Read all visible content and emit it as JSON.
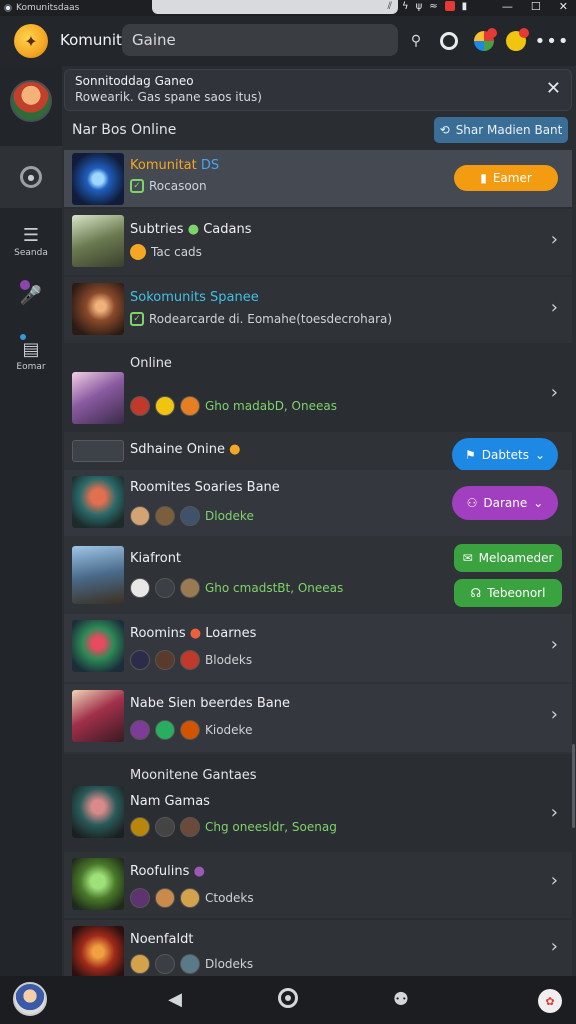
{
  "titlebar": {
    "app_name": "Komunitsdaas",
    "window_controls": [
      "—",
      "☐",
      "✕"
    ]
  },
  "header": {
    "brand": "Komunits",
    "search_value": "Gaine"
  },
  "sidebar": {
    "items": [
      {
        "label": "Seanda",
        "icon": "list-icon"
      },
      {
        "label": "",
        "icon": "mic-icon"
      },
      {
        "label": "Eomar",
        "icon": "flag-icon"
      }
    ]
  },
  "banner": {
    "title": "Sonnitoddag Ganeo",
    "subtitle": "Rowearik. Gas spane saos itus)",
    "close": "✕"
  },
  "now_online_label": "Nar Bos Online",
  "share_button": "Shar Madien Bant",
  "rows": [
    {
      "title": "Komunitat",
      "badge": "DS",
      "sub": "Rocasoon",
      "action": "Eamer"
    },
    {
      "title": "Subtries",
      "sub": "Tac cads"
    },
    {
      "title": "Sokomunits Spanee",
      "sub": "Rodearcarde di. Eomahe(toesdecrohara)"
    },
    {
      "group_label": "Online",
      "sub": "Gho madabD, Oneeas"
    },
    {
      "title": "Sdhaine Onine",
      "action": "Dabtets"
    },
    {
      "title": "Roomites Soaries Bane",
      "sub": "Dlodeke",
      "action": "Darane"
    },
    {
      "title": "Kiafront",
      "sub": "Gho cmadstBt, Oneeas",
      "action": "Meloameder",
      "action2": "Tebeonorl"
    },
    {
      "title": "Roomins",
      "title2": "Loarnes",
      "sub": "Blodeks"
    },
    {
      "title": "Nabe Sien beerdes Bane",
      "sub": "Kiodeke"
    },
    {
      "group_label": "Moonitene Gantaes",
      "title": "Nam Gamas",
      "sub": "Chg oneesldr, Soenag"
    },
    {
      "title": "Roofulins",
      "sub": "Ctodeks"
    },
    {
      "title": "Noenfaldt",
      "sub": "Dlodeks"
    }
  ],
  "colors": {
    "accent_orange": "#f39c12",
    "accent_blue": "#1e88e5",
    "accent_purple": "#a23fc0",
    "accent_green": "#3aa23e",
    "online_green": "#7fd36b"
  }
}
